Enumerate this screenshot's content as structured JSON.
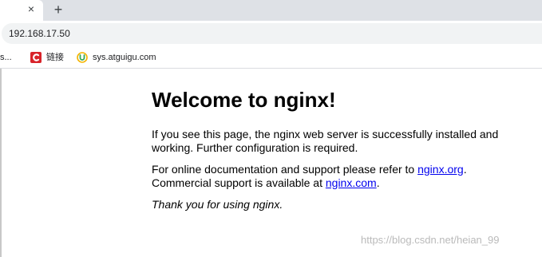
{
  "browser": {
    "tab": {
      "close_glyph": "×"
    },
    "new_tab_glyph": "+",
    "address": "192.168.17.50",
    "bookmarks": {
      "truncated": "s...",
      "items": [
        {
          "label": "链接",
          "icon": "csdn-c-icon",
          "color": "#d8232a"
        },
        {
          "label": "sys.atguigu.com",
          "icon": "u-logo-icon",
          "color": "#f4b400"
        }
      ]
    }
  },
  "page": {
    "heading": "Welcome to nginx!",
    "p1": "If you see this page, the nginx web server is successfully installed and working. Further configuration is required.",
    "p2_before": "For online documentation and support please refer to ",
    "p2_link1": "nginx.org",
    "p2_mid": ".\nCommercial support is available at ",
    "p2_link2": "nginx.com",
    "p2_after": ".",
    "thanks": "Thank you for using nginx."
  },
  "watermark": "https://blog.csdn.net/heian_99"
}
